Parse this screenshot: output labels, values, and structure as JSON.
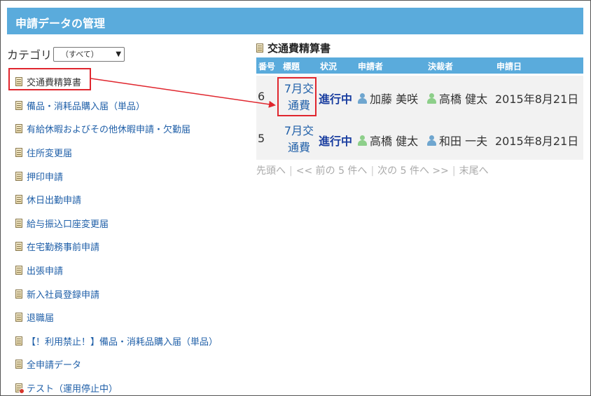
{
  "header": {
    "title": "申請データの管理"
  },
  "category": {
    "label": "カテゴリ",
    "selected": "（すべて）"
  },
  "categories": [
    {
      "label": "交通費精算書",
      "icon": "document-icon"
    },
    {
      "label": "備品・消耗品購入届（単品）",
      "icon": "document-icon"
    },
    {
      "label": "有給休暇およびその他休暇申請・欠勤届",
      "icon": "document-icon"
    },
    {
      "label": "住所変更届",
      "icon": "document-icon"
    },
    {
      "label": "押印申請",
      "icon": "document-icon"
    },
    {
      "label": "休日出勤申請",
      "icon": "document-icon"
    },
    {
      "label": "給与振込口座変更届",
      "icon": "document-icon"
    },
    {
      "label": "在宅勤務事前申請",
      "icon": "document-icon"
    },
    {
      "label": "出張申請",
      "icon": "document-icon"
    },
    {
      "label": "新入社員登録申請",
      "icon": "document-icon"
    },
    {
      "label": "退職届",
      "icon": "document-icon"
    },
    {
      "label": "【！利用禁止！】備品・消耗品購入届（単品）",
      "icon": "document-icon"
    },
    {
      "label": "全申請データ",
      "icon": "document-icon"
    },
    {
      "label": "テスト（運用停止中）",
      "icon": "document-stopped-icon"
    }
  ],
  "list": {
    "title": "交通費精算書",
    "columns": [
      "番号",
      "標題",
      "状況",
      "申請者",
      "決裁者",
      "申請日"
    ],
    "rows": [
      {
        "number": "6",
        "title_line1": "7月交",
        "title_line2": "通費",
        "status": "進行中",
        "applicant": "加藤 美咲",
        "applicant_icon": "blue",
        "approver": "高橋 健太",
        "approver_icon": "green",
        "date": "2015年8月21日"
      },
      {
        "number": "5",
        "title_line1": "7月交",
        "title_line2": "通費",
        "status": "進行中",
        "applicant": "高橋 健太",
        "applicant_icon": "green",
        "approver": "和田 一夫",
        "approver_icon": "blue",
        "date": "2015年8月21日"
      }
    ]
  },
  "pager": {
    "first": "先頭へ",
    "prev": "<< 前の 5 件へ",
    "next": "次の 5 件へ >>",
    "last": "末尾へ"
  },
  "colors": {
    "header": "#5aabdc",
    "link": "#1f5fa8",
    "status": "#1a3ea0",
    "highlight": "#e0262e"
  }
}
